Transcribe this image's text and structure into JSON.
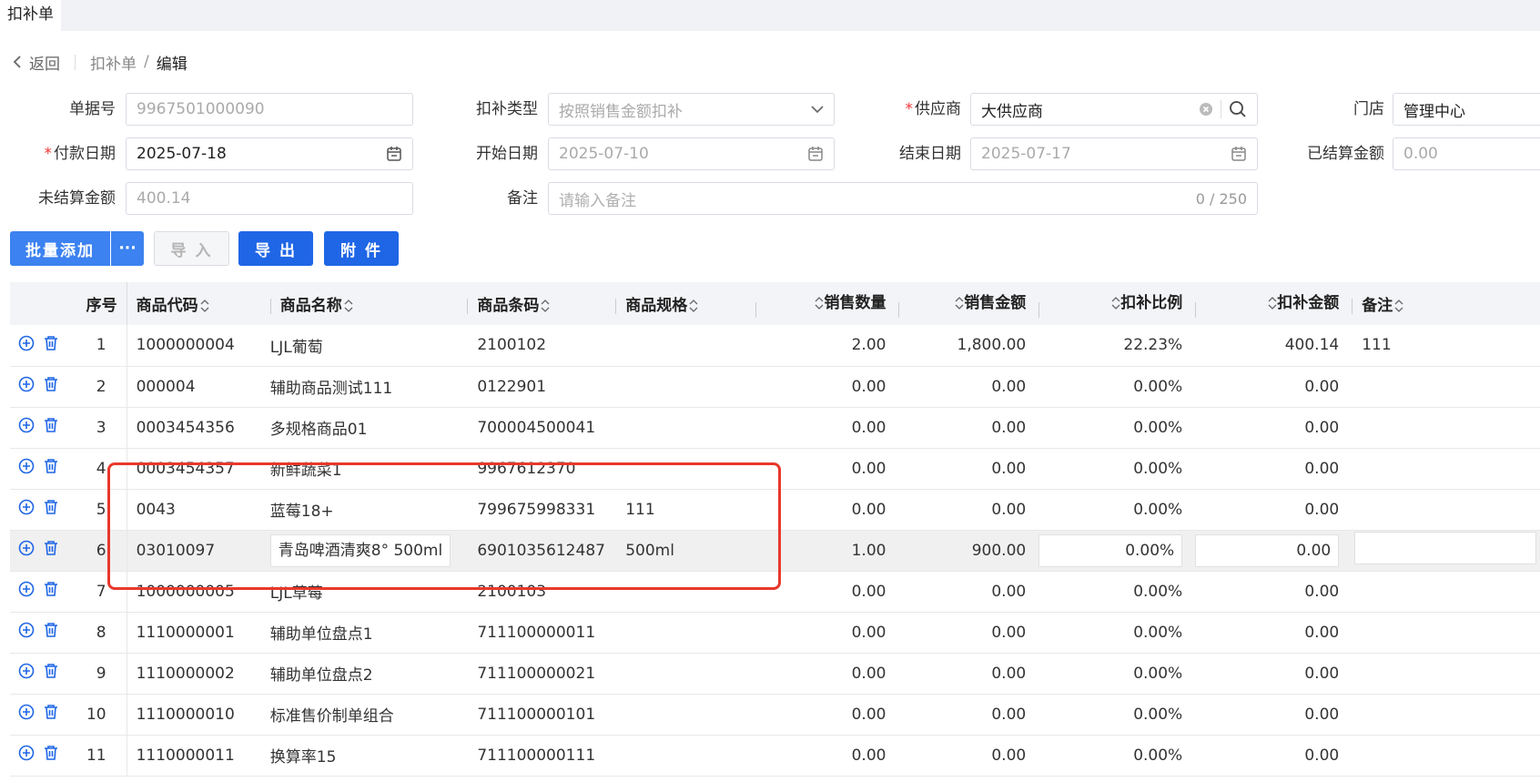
{
  "tab": {
    "title": "扣补单"
  },
  "breadcrumb": {
    "back": "返回",
    "section": "扣补单",
    "slash": "/",
    "current": "编辑"
  },
  "form": {
    "doc_no": {
      "label": "单据号",
      "value": "9967501000090"
    },
    "type": {
      "label": "扣补类型",
      "value": "按照销售金额扣补"
    },
    "supplier": {
      "label": "供应商",
      "value": "大供应商"
    },
    "store": {
      "label": "门店",
      "value": "管理中心"
    },
    "pay_date": {
      "label": "付款日期",
      "value": "2025-07-18"
    },
    "start_date": {
      "label": "开始日期",
      "value": "2025-07-10"
    },
    "end_date": {
      "label": "结束日期",
      "value": "2025-07-17"
    },
    "settled": {
      "label": "已结算金额",
      "value": "0.00"
    },
    "unsettled": {
      "label": "未结算金额",
      "value": "400.14"
    },
    "remark": {
      "label": "备注",
      "placeholder": "请输入备注",
      "counter": "0 / 250"
    }
  },
  "toolbar": {
    "batch_add": "批量添加",
    "more": "···",
    "import": "导 入",
    "export": "导 出",
    "attach": "附 件"
  },
  "table": {
    "headers": [
      "序号",
      "商品代码",
      "商品名称",
      "商品条码",
      "商品规格",
      "销售数量",
      "销售金额",
      "扣补比例",
      "扣补金额",
      "备注"
    ],
    "rows": [
      [
        "1",
        "1000000004",
        "LJL葡萄",
        "2100102",
        "",
        "2.00",
        "1,800.00",
        "22.23%",
        "400.14",
        "111"
      ],
      [
        "2",
        "000004",
        "辅助商品测试111",
        "0122901",
        "",
        "0.00",
        "0.00",
        "0.00%",
        "0.00",
        ""
      ],
      [
        "3",
        "0003454356",
        "多规格商品01",
        "700004500041",
        "",
        "0.00",
        "0.00",
        "0.00%",
        "0.00",
        ""
      ],
      [
        "4",
        "0003454357",
        "新鲜蔬菜1",
        "9967612370",
        "",
        "0.00",
        "0.00",
        "0.00%",
        "0.00",
        ""
      ],
      [
        "5",
        "0043",
        "蓝莓18+",
        "799675998331",
        "111",
        "0.00",
        "0.00",
        "0.00%",
        "0.00",
        ""
      ],
      [
        "6",
        "03010097",
        "青岛啤酒清爽8° 500ml",
        "6901035612487",
        "500ml",
        "1.00",
        "900.00",
        "0.00%",
        "0.00",
        ""
      ],
      [
        "7",
        "1000000005",
        "LJL草莓",
        "2100103",
        "",
        "0.00",
        "0.00",
        "0.00%",
        "0.00",
        ""
      ],
      [
        "8",
        "1110000001",
        "辅助单位盘点1",
        "711100000011",
        "",
        "0.00",
        "0.00",
        "0.00%",
        "0.00",
        ""
      ],
      [
        "9",
        "1110000002",
        "辅助单位盘点2",
        "711100000021",
        "",
        "0.00",
        "0.00",
        "0.00%",
        "0.00",
        ""
      ],
      [
        "10",
        "1110000010",
        "标准售价制单组合",
        "711100000101",
        "",
        "0.00",
        "0.00",
        "0.00%",
        "0.00",
        ""
      ],
      [
        "11",
        "1110000011",
        "换算率15",
        "711100000111",
        "",
        "0.00",
        "0.00",
        "0.00%",
        "0.00",
        ""
      ]
    ]
  },
  "colors": {
    "primary": "#1f66e6",
    "highlight_box": "#e8382b",
    "required": "#e33"
  }
}
